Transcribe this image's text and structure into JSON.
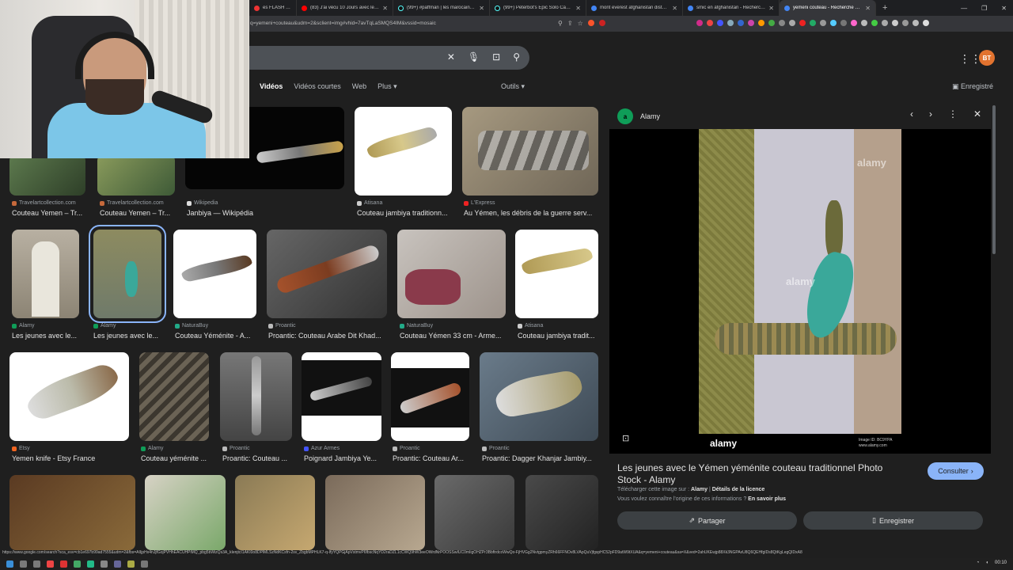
{
  "browser": {
    "tabs": [
      {
        "title": "es FLASH | U..."
      },
      {
        "title": "(83) J'ai vécu 10 Jours avec les Talibans"
      },
      {
        "title": "(99+) #paffman | les marocaines | Tik"
      },
      {
        "title": "(99+) Peterbot's Epic Solo Cash Cup"
      },
      {
        "title": "mont everest afghanistan distance"
      },
      {
        "title": "smic en afghanistan - Recherche Go"
      },
      {
        "title": "yemeni couteau - Recherche Goo",
        "active": true
      }
    ],
    "new_tab": "+",
    "url": "q=yemeni+couteau&udm=2&sclient=img#vhid=7avTqLaSMQS4IM&vssid=mosaic"
  },
  "google": {
    "avatar_initials": "BT",
    "filters": [
      "Vidéos",
      "Vidéos courtes",
      "Web",
      "Plus ▾"
    ],
    "tools": "Outils ▾",
    "saved": "Enregistré"
  },
  "results": [
    {
      "source": "Travelartcollection.com",
      "caption": "Couteau Yemen – Tr..."
    },
    {
      "source": "Travelartcollection.com",
      "caption": "Couteau Yemen – Tr..."
    },
    {
      "source": "Wikipedia",
      "caption": "Janbiya — Wikipédia"
    },
    {
      "source": "Atisana",
      "caption": "Couteau jambiya traditionn..."
    },
    {
      "source": "L'Express",
      "caption": "Au Yémen, les débris de la guerre serv..."
    },
    {
      "source": "Alamy",
      "caption": "Les jeunes avec le..."
    },
    {
      "source": "Alamy",
      "caption": "Les jeunes avec le..."
    },
    {
      "source": "NaturaBuy",
      "caption": "Couteau Yéménite - A..."
    },
    {
      "source": "Proantic",
      "caption": "Proantic: Couteau Arabe Dit Khad..."
    },
    {
      "source": "NaturaBuy",
      "caption": "Couteau Yémen 33 cm - Arme..."
    },
    {
      "source": "Atisana",
      "caption": "Couteau jambiya tradit..."
    },
    {
      "source": "Etsy",
      "caption": "Yemen knife - Etsy France"
    },
    {
      "source": "Alamy",
      "caption": "Couteau yéménite ..."
    },
    {
      "source": "Proantic",
      "caption": "Proantic: Couteau ..."
    },
    {
      "source": "Azur Armes",
      "caption": "Poignard Jambiya Ye..."
    },
    {
      "source": "Proantic",
      "caption": "Proantic: Couteau Ar..."
    },
    {
      "source": "Proantic",
      "caption": "Proantic: Dagger Khanjar Jambiy..."
    }
  ],
  "panel": {
    "site": "Alamy",
    "title": "Les jeunes avec le Yémen yéménite couteau traditionnel Photo Stock - Alamy",
    "consult": "Consulter",
    "download_prefix": "Télécharger cette image sur :",
    "download_site": "Alamy",
    "license": "Détails de la licence",
    "origin_q": "Vous voulez connaître l'origine de ces informations ?",
    "origin_link": "En savoir plus",
    "share": "Partager",
    "save": "Enregistrer",
    "watermark": "alamy",
    "image_id": "Image ID: BC9YPA\nwww.alamy.com"
  },
  "status_url": "https://www.google.com/search?sca_esv=cb1e697b99ad7555&udm=2&fbs=AIIjpHx4nJjfGojPVHhEACUHPiMQ_pbg5bWizQs3A_kIenjtcI1AKI0o8DPlMLSzNdKCsfn-2sv_ZbgbMPHLK7-q-IfyYQPGjApVstmvP6fbscNqYD2raDZL1cCWQ9hW3eeOWrdNrPOOSSwIUC0mIigOHZPr3BbftrdcoWwQo-FjHVGg2NvtgpmyZRh66FFNOv8LVApQuVjfgspHC52pFD9atW9tXUA&q=yemeni+couteau&sa=X&ved=2ahUKEwjp88Xk3NGPAxU8Q6QEHfgIDs8QtKgLegQIDxA8",
  "clock": "00:10"
}
